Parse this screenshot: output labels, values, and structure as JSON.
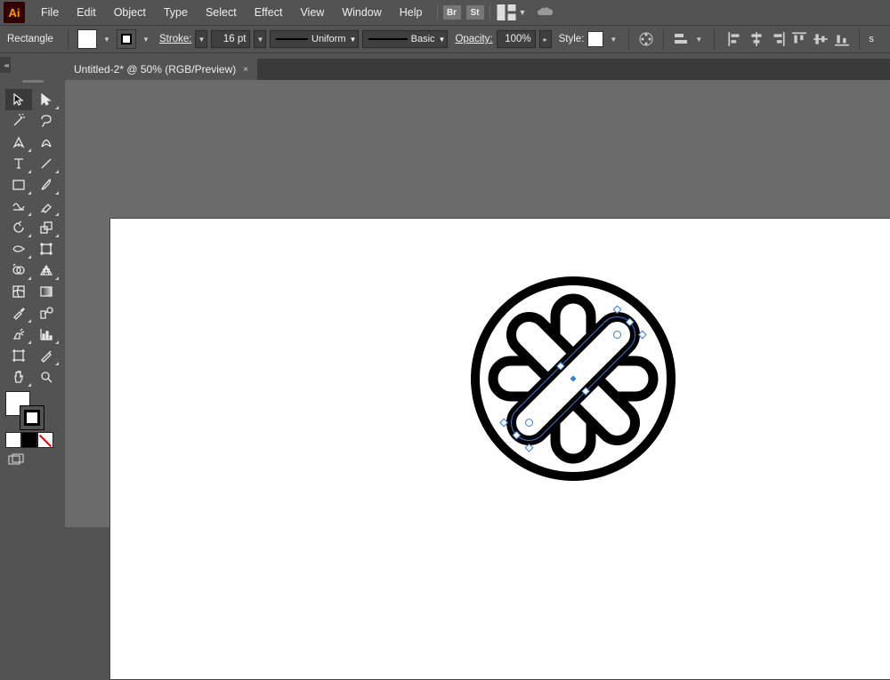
{
  "menubar": {
    "items": [
      "File",
      "Edit",
      "Object",
      "Type",
      "Select",
      "Effect",
      "View",
      "Window",
      "Help"
    ]
  },
  "controlbar": {
    "shape": "Rectangle",
    "stroke_label": "Stroke:",
    "stroke_size": "16 pt",
    "profile": "Uniform",
    "brush": "Basic",
    "opacity_label": "Opacity:",
    "opacity_val": "100%",
    "style_label": "Style:"
  },
  "tab": {
    "title": "Untitled-2* @ 50% (RGB/Preview)",
    "close": "×"
  }
}
